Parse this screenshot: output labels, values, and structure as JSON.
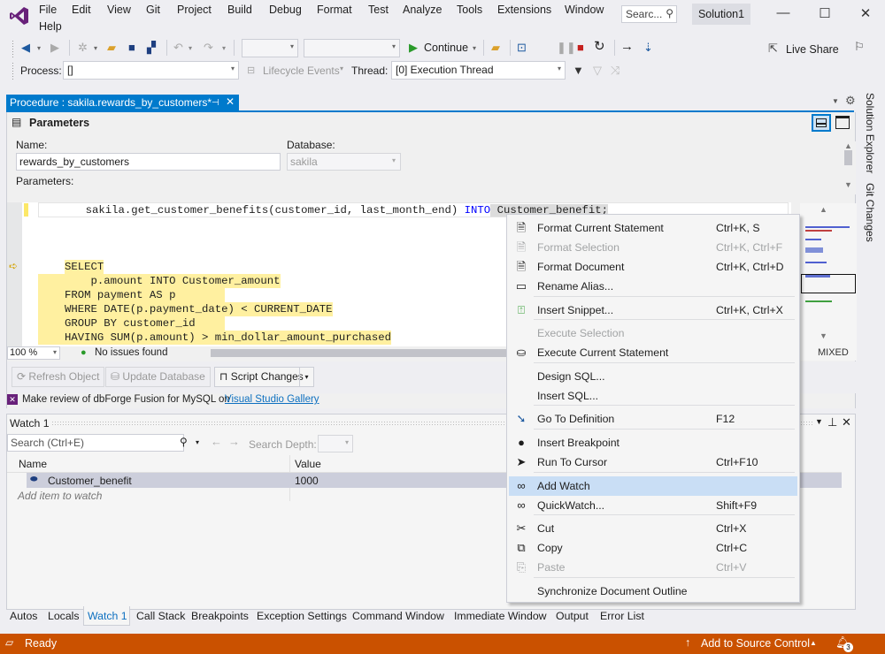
{
  "app": {
    "title": "Solution1",
    "search_placeholder": "Searc...",
    "brand_color": "#68217a",
    "accent": "#007acc",
    "status_color": "#ca5100"
  },
  "menu": [
    "File",
    "Edit",
    "View",
    "Git",
    "Project",
    "Build",
    "Debug",
    "Format",
    "Test",
    "Analyze",
    "Tools",
    "Extensions",
    "Window",
    "Help"
  ],
  "toolbar": {
    "continue_label": "Continue",
    "live_share": "Live Share",
    "process_label": "Process:",
    "process_value": "[]",
    "lifecycle_label": "Lifecycle Events",
    "thread_label": "Thread:",
    "thread_value": "[0] Execution Thread"
  },
  "doc_tab": {
    "title": "Procedure : sakila.rewards_by_customers*"
  },
  "parameters": {
    "header": "Parameters",
    "name_label": "Name:",
    "name_value": "rewards_by_customers",
    "db_label": "Database:",
    "db_value": "sakila",
    "params_label": "Parameters:"
  },
  "editor": {
    "lines": [
      {
        "text": "       sakila.get_customer_benefits(customer_id, last_month_end) ",
        "kw": "INTO",
        "rest": " Customer_benefit;"
      },
      {
        "text": "SELECT"
      },
      {
        "text": "  p.amount INTO Customer_amount"
      },
      {
        "text": "FROM payment AS p"
      },
      {
        "text": "WHERE DATE(p.payment_date) < CURRENT_DATE"
      },
      {
        "text": "GROUP BY customer_id"
      },
      {
        "text": "HAVING SUM(p.amount) > min_dollar_amount_purchased"
      }
    ],
    "zoom": "100 %",
    "issues": "No issues found",
    "mode": "MIXED"
  },
  "actions": {
    "refresh": "Refresh Object",
    "update": "Update Database",
    "script": "Script Changes"
  },
  "review": {
    "text": "Make review of dbForge Fusion for MySQL on ",
    "link": "Visual Studio Gallery"
  },
  "context_menu": [
    {
      "label": "Format Current Statement",
      "shortcut": "Ctrl+K, S",
      "icon": "format-statement-icon",
      "disabled": false
    },
    {
      "label": "Format Selection",
      "shortcut": "Ctrl+K, Ctrl+F",
      "icon": "format-selection-icon",
      "disabled": true
    },
    {
      "label": "Format Document",
      "shortcut": "Ctrl+K, Ctrl+D",
      "icon": "format-document-icon",
      "disabled": false
    },
    {
      "label": "Rename Alias...",
      "shortcut": "",
      "icon": "rename-icon",
      "disabled": false
    },
    {
      "label": "Insert Snippet...",
      "shortcut": "Ctrl+K, Ctrl+X",
      "icon": "snippet-icon",
      "disabled": false
    },
    {
      "label": "Execute Selection",
      "shortcut": "",
      "icon": "",
      "disabled": true
    },
    {
      "label": "Execute Current Statement",
      "shortcut": "",
      "icon": "execute-icon",
      "disabled": false
    },
    {
      "label": "Design SQL...",
      "shortcut": "",
      "icon": "",
      "disabled": false
    },
    {
      "label": "Insert SQL...",
      "shortcut": "",
      "icon": "",
      "disabled": false
    },
    {
      "label": "Go To Definition",
      "shortcut": "F12",
      "icon": "goto-definition-icon",
      "disabled": false
    },
    {
      "label": "Insert Breakpoint",
      "shortcut": "",
      "icon": "breakpoint-icon",
      "disabled": false
    },
    {
      "label": "Run To Cursor",
      "shortcut": "Ctrl+F10",
      "icon": "cursor-icon",
      "disabled": false
    },
    {
      "label": "Add Watch",
      "shortcut": "",
      "icon": "glasses-icon",
      "disabled": false,
      "highlighted": true
    },
    {
      "label": "QuickWatch...",
      "shortcut": "Shift+F9",
      "icon": "glasses-icon",
      "disabled": false
    },
    {
      "label": "Cut",
      "shortcut": "Ctrl+X",
      "icon": "scissors-icon",
      "disabled": false
    },
    {
      "label": "Copy",
      "shortcut": "Ctrl+C",
      "icon": "copy-icon",
      "disabled": false
    },
    {
      "label": "Paste",
      "shortcut": "Ctrl+V",
      "icon": "paste-icon",
      "disabled": true
    },
    {
      "label": "Synchronize Document Outline",
      "shortcut": "",
      "icon": "",
      "disabled": false
    }
  ],
  "watch": {
    "title": "Watch 1",
    "search_placeholder": "Search (Ctrl+E)",
    "search_depth": "Search Depth:",
    "col_name": "Name",
    "col_value": "Value",
    "rows": [
      {
        "name": "Customer_benefit",
        "value": "1000"
      }
    ],
    "add_placeholder": "Add item to watch"
  },
  "bottom_tabs": [
    "Autos",
    "Locals",
    "Watch 1",
    "Call Stack",
    "Breakpoints",
    "Exception Settings",
    "Command Window",
    "Immediate Window",
    "Output",
    "Error List"
  ],
  "side_tabs": [
    "Solution Explorer",
    "Git Changes"
  ],
  "status": {
    "text": "Ready",
    "source_control": "Add to Source Control",
    "notifications": "3"
  }
}
